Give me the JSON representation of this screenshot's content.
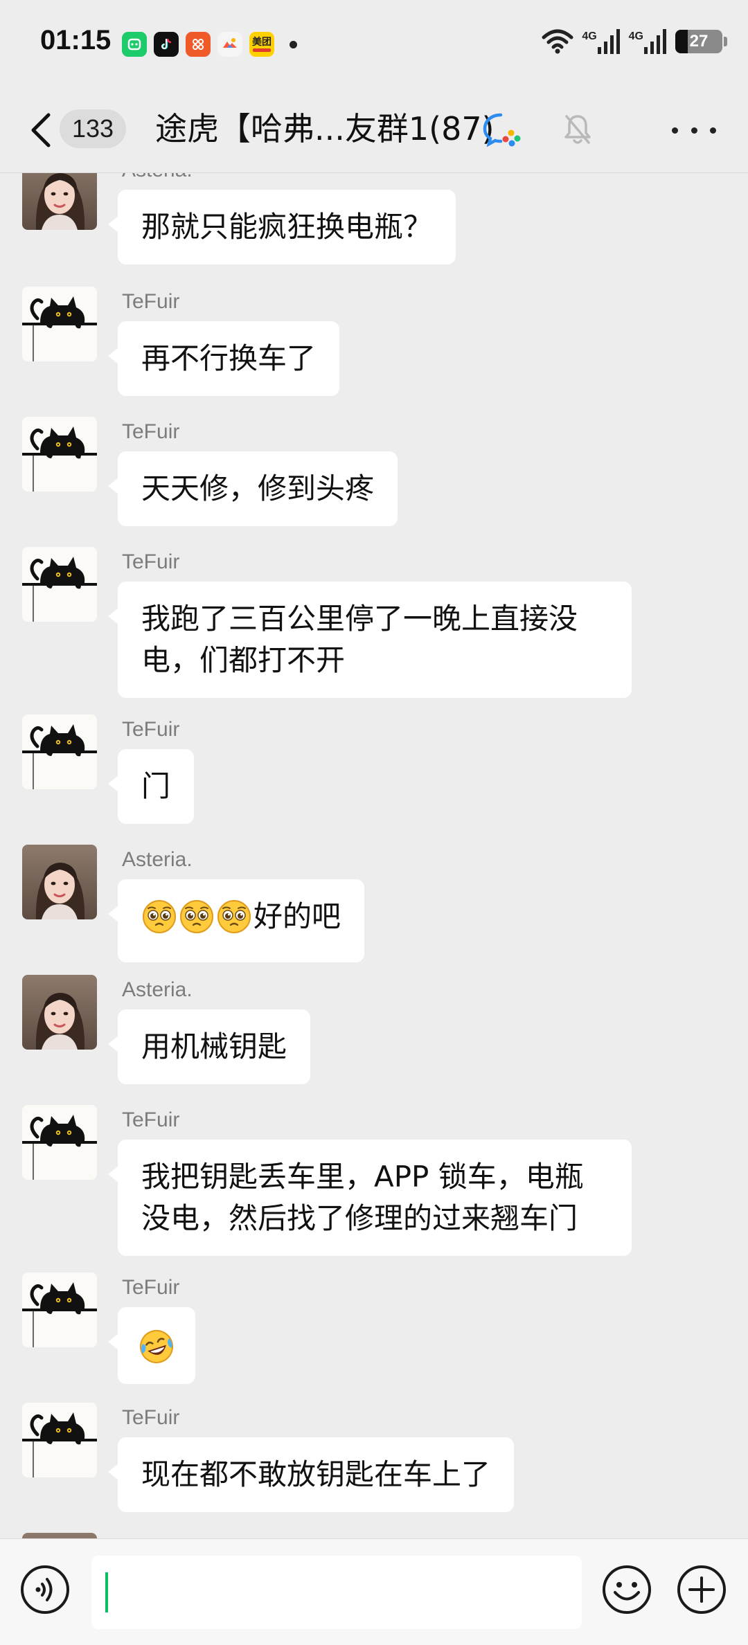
{
  "status_bar": {
    "time": "01:15",
    "network_1": "4G",
    "network_2": "4G",
    "battery": "27",
    "apps": [
      {
        "icon": "wechat-mini-icon",
        "color": "#1ecb6b"
      },
      {
        "icon": "tiktok-icon",
        "color": "#111111"
      },
      {
        "icon": "app-grid-icon",
        "color": "#f05a28"
      },
      {
        "icon": "game-icon",
        "color": "#f5f5f5"
      },
      {
        "icon": "meituan-icon",
        "color": "#ffd100",
        "label": "美团"
      }
    ]
  },
  "header": {
    "unread_count": "133",
    "title": "途虎【哈弗...友群1(87)"
  },
  "messages": [
    {
      "sender": "Asteria.",
      "avatar": "asteria",
      "text": "那就只能疯狂换电瓶？"
    },
    {
      "sender": "TeFuir",
      "avatar": "cat",
      "text": "再不行换车了"
    },
    {
      "sender": "TeFuir",
      "avatar": "cat",
      "text": "天天修，修到头疼"
    },
    {
      "sender": "TeFuir",
      "avatar": "cat",
      "text": "我跑了三百公里停了一晚上直接没电，们都打不开"
    },
    {
      "sender": "TeFuir",
      "avatar": "cat",
      "text": "门"
    },
    {
      "sender": "Asteria.",
      "avatar": "asteria",
      "text": "好的吧",
      "emojis": [
        "pleading-face-icon",
        "pleading-face-icon",
        "pleading-face-icon"
      ]
    },
    {
      "sender": "Asteria.",
      "avatar": "asteria",
      "text": "用机械钥匙"
    },
    {
      "sender": "TeFuir",
      "avatar": "cat",
      "text": "我把钥匙丢车里，APP 锁车，电瓶没电，然后找了修理的过来翘车门"
    },
    {
      "sender": "TeFuir",
      "avatar": "cat",
      "text": "",
      "emojis": [
        "laughing-crying-face-icon"
      ]
    },
    {
      "sender": "TeFuir",
      "avatar": "cat",
      "text": "现在都不敢放钥匙在车上了"
    }
  ],
  "input": {
    "value": "",
    "placeholder": ""
  },
  "colors": {
    "background": "#ededed",
    "bubble": "#ffffff",
    "accent_caret": "#07c160",
    "sender_name": "#7c7c7c"
  }
}
